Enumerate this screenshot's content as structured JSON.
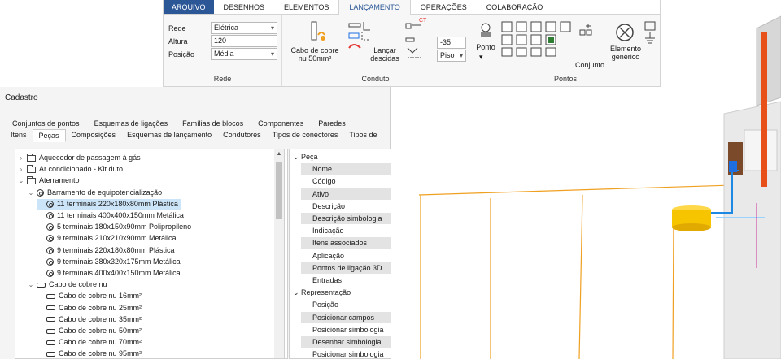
{
  "ribbon": {
    "tabs": [
      "ARQUIVO",
      "DESENHOS",
      "ELEMENTOS",
      "LANÇAMENTO",
      "OPERAÇÕES",
      "COLABORAÇÃO"
    ],
    "active_tab": "LANÇAMENTO",
    "rede": {
      "label": "Rede",
      "fields": [
        {
          "label": "Rede",
          "value": "Elétrica"
        },
        {
          "label": "Altura",
          "value": "120"
        },
        {
          "label": "Posição",
          "value": "Média"
        }
      ]
    },
    "conduto": {
      "label": "Conduto",
      "cabo_label_1": "Cabo de cobre",
      "cabo_label_2": "nu 50mm²",
      "lancar_1": "Lançar",
      "lancar_2": "descidas",
      "ct_text": "CT",
      "height_value": "-35",
      "floor_value": "Piso"
    },
    "pontos": {
      "label": "Pontos",
      "ponto_label": "Ponto",
      "conjunto_label": "Conjunto",
      "elemento_1": "Elemento",
      "elemento_2": "genérico"
    }
  },
  "cadastro": {
    "title": "Cadastro",
    "tabs_row1": [
      "Conjuntos de pontos",
      "Esquemas de ligações",
      "Famílias de blocos",
      "Componentes",
      "Paredes"
    ],
    "tabs_row2": [
      "Itens",
      "Peças",
      "Composições",
      "Esquemas de lançamento",
      "Condutores",
      "Tipos de conectores",
      "Tipos de"
    ],
    "active_tab2": "Peças",
    "tree": [
      {
        "label": "Aquecedor de passagem à gás",
        "depth": 0,
        "icon": "folder",
        "chev": "right"
      },
      {
        "label": "Ar condicionado - Kit duto",
        "depth": 0,
        "icon": "folder",
        "chev": "right"
      },
      {
        "label": "Aterramento",
        "depth": 0,
        "icon": "folder",
        "chev": "down"
      },
      {
        "label": "Barramento de equipotencialização",
        "depth": 1,
        "icon": "ring",
        "chev": "down"
      },
      {
        "label": "11 terminais  220x180x80mm Plástica",
        "depth": 2,
        "icon": "ring",
        "chev": "",
        "selected": true
      },
      {
        "label": "11 terminais 400x400x150mm Metálica",
        "depth": 2,
        "icon": "ring",
        "chev": ""
      },
      {
        "label": "5 terminais 180x150x90mm Polipropileno",
        "depth": 2,
        "icon": "ring",
        "chev": ""
      },
      {
        "label": "9 terminais 210x210x90mm Metálica",
        "depth": 2,
        "icon": "ring",
        "chev": ""
      },
      {
        "label": "9 terminais 220x180x80mm Plástica",
        "depth": 2,
        "icon": "ring",
        "chev": ""
      },
      {
        "label": "9 terminais 380x320x175mm Metálica",
        "depth": 2,
        "icon": "ring",
        "chev": ""
      },
      {
        "label": "9 terminais 400x400x150mm Metálica",
        "depth": 2,
        "icon": "ring",
        "chev": ""
      },
      {
        "label": "Cabo de cobre nu",
        "depth": 1,
        "icon": "cable",
        "chev": "down"
      },
      {
        "label": "Cabo de cobre nu 16mm²",
        "depth": 2,
        "icon": "cable",
        "chev": ""
      },
      {
        "label": "Cabo de cobre nu 25mm²",
        "depth": 2,
        "icon": "cable",
        "chev": ""
      },
      {
        "label": "Cabo de cobre nu 35mm²",
        "depth": 2,
        "icon": "cable",
        "chev": ""
      },
      {
        "label": "Cabo de cobre nu 50mm²",
        "depth": 2,
        "icon": "cable",
        "chev": ""
      },
      {
        "label": "Cabo de cobre nu 70mm²",
        "depth": 2,
        "icon": "cable",
        "chev": ""
      },
      {
        "label": "Cabo de cobre nu 95mm²",
        "depth": 2,
        "icon": "cable",
        "chev": ""
      }
    ],
    "properties": [
      {
        "label": "Peça",
        "category": true
      },
      {
        "label": "Nome"
      },
      {
        "label": "Código",
        "white": true
      },
      {
        "label": "Ativo"
      },
      {
        "label": "Descrição",
        "white": true
      },
      {
        "label": "Descrição simbologia"
      },
      {
        "label": "Indicação",
        "white": true
      },
      {
        "label": "Itens associados"
      },
      {
        "label": "Aplicação",
        "white": true
      },
      {
        "label": "Pontos de ligação 3D"
      },
      {
        "label": "Entradas",
        "white": true
      },
      {
        "label": "Representação",
        "category": true
      },
      {
        "label": "Posição",
        "white": true
      },
      {
        "label": "Posicionar campos"
      },
      {
        "label": "Posicionar simbologia",
        "white": true
      },
      {
        "label": "Desenhar simbologia"
      },
      {
        "label": "Posicionar simbologia",
        "white": true
      }
    ]
  },
  "colors": {
    "accent": "#2b5797",
    "selection": "#cce4f7",
    "cable_orange": "#f0a020",
    "pipe_blue": "#1e88e5",
    "box_yellow": "#f7c400"
  }
}
